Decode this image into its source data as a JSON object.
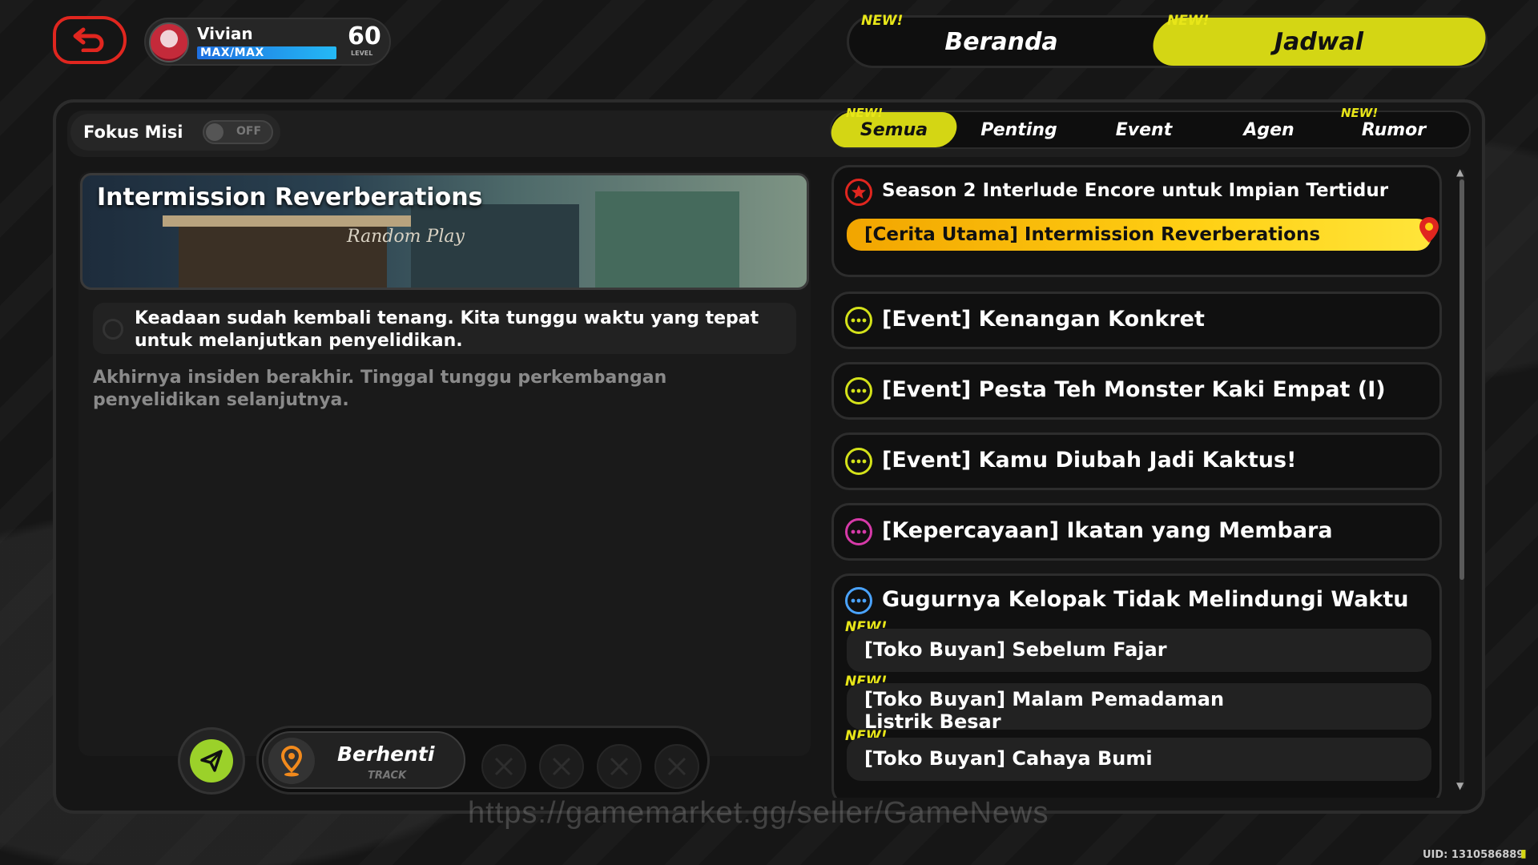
{
  "header": {
    "player_name": "Vivian",
    "exp_text": "MAX/MAX",
    "level": "60",
    "level_label": "LEVEL",
    "tabs": [
      {
        "label": "Beranda",
        "new": "NEW!",
        "active": false
      },
      {
        "label": "Jadwal",
        "new": "NEW!",
        "active": true
      }
    ]
  },
  "filter": {
    "label": "Fokus Misi",
    "toggle_state": "OFF"
  },
  "categories": [
    {
      "label": "Semua",
      "new": "NEW!",
      "active": true
    },
    {
      "label": "Penting",
      "new": "",
      "active": false
    },
    {
      "label": "Event",
      "new": "",
      "active": false
    },
    {
      "label": "Agen",
      "new": "",
      "active": false
    },
    {
      "label": "Rumor",
      "new": "NEW!",
      "active": false
    }
  ],
  "detail": {
    "title": "Intermission Reverberations",
    "banner_sign": "Random Play",
    "objective": "Keadaan sudah kembali tenang. Kita tunggu waktu yang tepat untuk melanjutkan penyelidikan.",
    "description": "Akhirnya insiden berakhir. Tinggal tunggu perkembangan penyelidikan selanjutnya."
  },
  "track": {
    "label": "Berhenti",
    "sub": "TRACK"
  },
  "quests": {
    "season": {
      "title": "Season 2 Interlude Encore untuk Impian Tertidur",
      "selected": "[Cerita Utama] Intermission Reverberations"
    },
    "events": [
      "[Event] Kenangan Konkret",
      "[Event] Pesta Teh Monster Kaki Empat (I)",
      "[Event] Kamu Diubah Jadi Kaktus!",
      "[Kepercayaan] Ikatan yang Membara"
    ],
    "group": {
      "title": "Gugurnya Kelopak Tidak Melindungi Waktu",
      "items": [
        {
          "new": "NEW!",
          "label": "[Toko Buyan] Sebelum Fajar"
        },
        {
          "new": "NEW!",
          "label": "[Toko Buyan] Malam Pemadaman Listrik Besar"
        },
        {
          "new": "NEW!",
          "label": "[Toko Buyan] Cahaya Bumi"
        }
      ]
    }
  },
  "footer": {
    "watermark": "https://gamemarket.gg/seller/GameNews",
    "uid": "UID: 1310586889"
  },
  "colors": {
    "accent_yellow": "#d4d614",
    "back_red": "#e0261f",
    "event_icon": "#d4e21a",
    "trust_icon": "#d63aa8",
    "group_icon": "#4aa3ff",
    "main_story_gradient": "#ffd014"
  }
}
